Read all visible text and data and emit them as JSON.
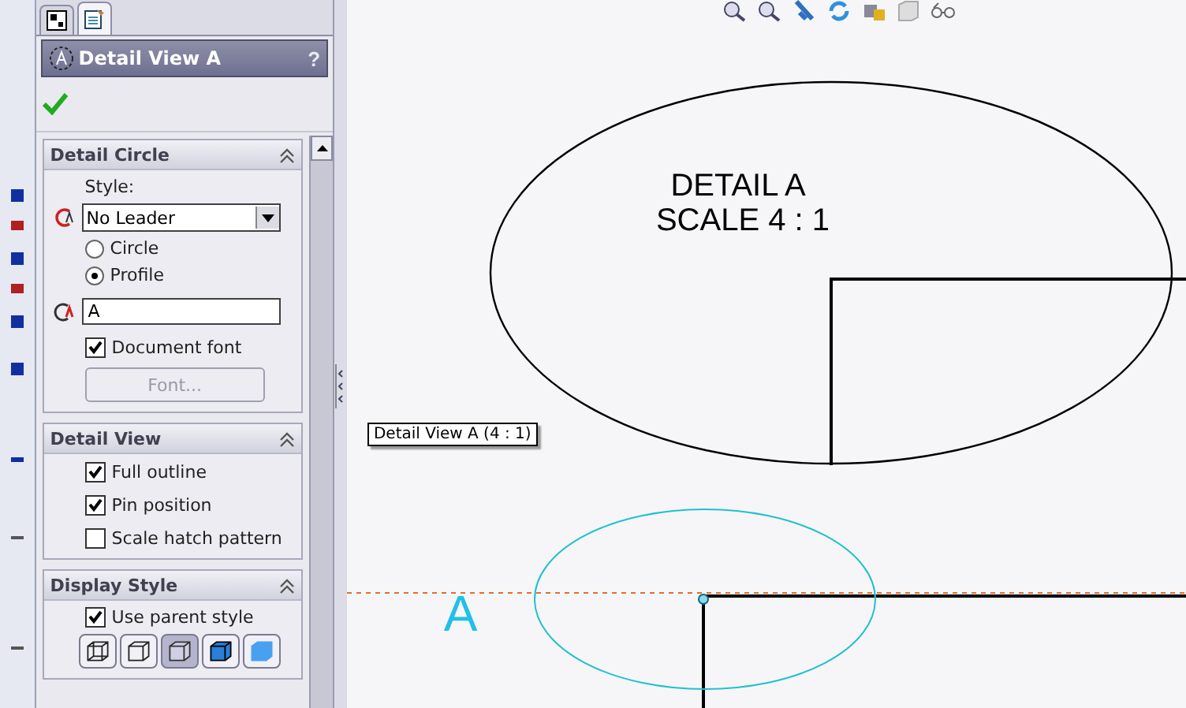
{
  "tabs": [
    {
      "kind": "tree",
      "selected": false
    },
    {
      "kind": "properties",
      "selected": true
    }
  ],
  "panel": {
    "title": "Detail View A",
    "help": "?"
  },
  "detail_circle": {
    "title": "Detail Circle",
    "expanded": true,
    "style_label": "Style:",
    "style_value": "No Leader",
    "shapes": [
      {
        "label": "Circle",
        "selected": false
      },
      {
        "label": "Profile",
        "selected": true
      }
    ],
    "label_value": "A",
    "document_font": {
      "label": "Document font",
      "checked": true
    },
    "font_button": {
      "label": "Font...",
      "disabled": true
    }
  },
  "detail_view": {
    "title": "Detail View",
    "expanded": true,
    "options": [
      {
        "label": "Full outline",
        "checked": true
      },
      {
        "label": "Pin position",
        "checked": true
      },
      {
        "label": "Scale hatch pattern",
        "checked": false
      }
    ]
  },
  "display_style": {
    "title": "Display Style",
    "expanded": true,
    "use_parent": {
      "label": "Use parent style",
      "checked": true
    },
    "modes": [
      {
        "kind": "wireframe",
        "selected": false
      },
      {
        "kind": "hidden_visible",
        "selected": false
      },
      {
        "kind": "hidden_removed",
        "selected": true
      },
      {
        "kind": "shaded_edges",
        "selected": false
      },
      {
        "kind": "shaded",
        "selected": false
      }
    ]
  },
  "canvas": {
    "detail_title": "DETAIL A",
    "detail_scale": "SCALE 4 : 1",
    "tooltip": "Detail View A (4 : 1)",
    "circle_label": "A"
  }
}
